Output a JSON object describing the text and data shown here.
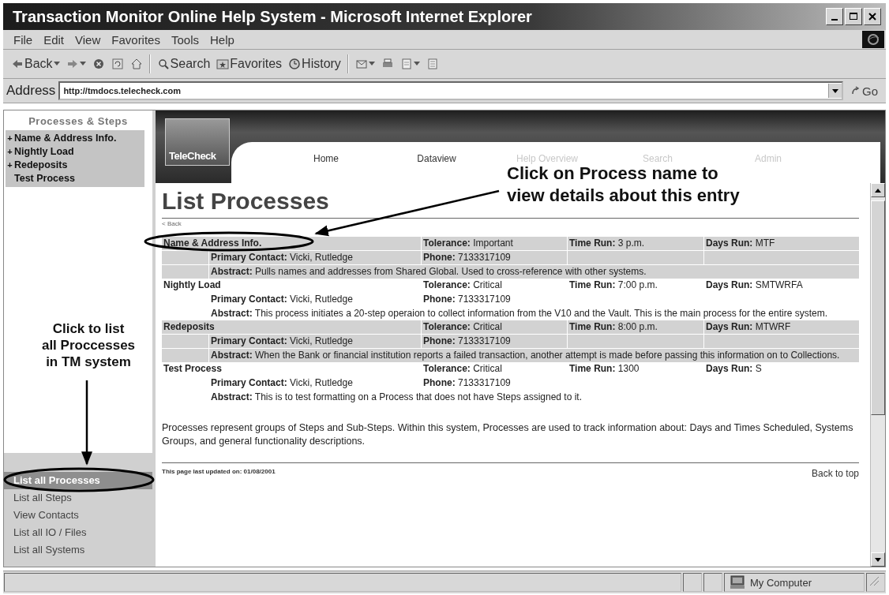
{
  "window": {
    "title": "Transaction Monitor Online Help System - Microsoft Internet Explorer"
  },
  "menu": [
    "File",
    "Edit",
    "View",
    "Favorites",
    "Tools",
    "Help"
  ],
  "toolbar": [
    {
      "kind": "back",
      "label": "Back"
    },
    {
      "kind": "forward"
    },
    {
      "kind": "stop"
    },
    {
      "kind": "refresh"
    },
    {
      "kind": "home"
    },
    {
      "kind": "search",
      "label": "Search"
    },
    {
      "kind": "favorites",
      "label": "Favorites"
    },
    {
      "kind": "history",
      "label": "History"
    },
    {
      "kind": "mail"
    },
    {
      "kind": "print"
    },
    {
      "kind": "edit"
    },
    {
      "kind": "discuss"
    }
  ],
  "address": {
    "label": "Address",
    "value": "http://tmdocs.telecheck.com",
    "go": "Go"
  },
  "sidebar": {
    "title": "Processes & Steps",
    "processes": [
      {
        "marker": "+",
        "label": "Name & Address Info."
      },
      {
        "marker": "+",
        "label": "Nightly Load"
      },
      {
        "marker": "+",
        "label": "Redeposits"
      },
      {
        "label": "Test Process"
      }
    ],
    "links": [
      {
        "label": "List all Processes",
        "selected": true
      },
      {
        "label": "List all Steps",
        "selected": false
      },
      {
        "label": "View Contacts",
        "selected": false
      },
      {
        "label": "List all IO / Files",
        "selected": false
      },
      {
        "label": "List all Systems",
        "selected": false
      }
    ]
  },
  "site": {
    "logo": "TeleCheck",
    "nav": [
      {
        "label": "Home",
        "disabled": false
      },
      {
        "label": "Dataview",
        "disabled": false
      },
      {
        "label": "Help Overview",
        "disabled": true
      },
      {
        "label": "Search",
        "disabled": true
      },
      {
        "label": "Admin",
        "disabled": true
      }
    ]
  },
  "page": {
    "title": "List Processes",
    "back": "< Back",
    "processes": [
      {
        "name": "Name & Address Info.",
        "shaded": true,
        "tolerance": "**Tolerance:** Important",
        "time_run": "**Time Run:** 3 p.m.",
        "days_run": "**Days Run:** MTF",
        "contact": "**Primary Contact:** Vicki, Rutledge",
        "phone": "**Phone:** 7133317109",
        "abstract": "**Abstract:** Pulls names and addresses from Shared Global. Used to cross-reference with other systems."
      },
      {
        "name": "Nightly Load",
        "shaded": false,
        "tolerance": "**Tolerance:** Critical",
        "time_run": "**Time Run:** 7:00 p.m.",
        "days_run": "**Days Run:** SMTWRFA",
        "contact": "**Primary Contact:** Vicki, Rutledge",
        "phone": "**Phone:** 7133317109",
        "abstract": "**Abstract:** This process initiates a 20-step operaion to collect information from the V10 and the Vault. This is the main process for the entire system."
      },
      {
        "name": "Redeposits",
        "shaded": true,
        "tolerance": "**Tolerance:** Critical",
        "time_run": "**Time Run:** 8:00 p.m.",
        "days_run": "**Days Run:** MTWRF",
        "contact": "**Primary Contact:** Vicki, Rutledge",
        "phone": "**Phone:** 7133317109",
        "abstract": "**Abstract:** When the Bank or financial institution reports a failed transaction, another attempt is made before passing this information on to Collections."
      },
      {
        "name": "Test Process",
        "shaded": false,
        "tolerance": "**Tolerance:** Critical",
        "time_run": "**Time Run:** 1300",
        "days_run": "**Days Run:** S",
        "contact": "**Primary Contact:** Vicki, Rutledge",
        "phone": "**Phone:** 7133317109",
        "abstract": "**Abstract:** This is to test formatting on a Process that does not have Steps assigned to it."
      }
    ],
    "description": "Processes represent groups of Steps and Sub-Steps. Within this system, Processes are used to track information about: Days and Times Scheduled, Systems Groups, and general functionality descriptions.",
    "updated": "This page last updated on: 01/08/2001",
    "back_to_top": "Back to top"
  },
  "status_bar": {
    "zone": "My Computer"
  },
  "annotations": [
    {
      "lines": [
        "Click on Process name to",
        "view details about this entry"
      ]
    },
    {
      "lines": [
        "Click to list",
        "all Proccesses",
        "in TM system"
      ]
    }
  ]
}
